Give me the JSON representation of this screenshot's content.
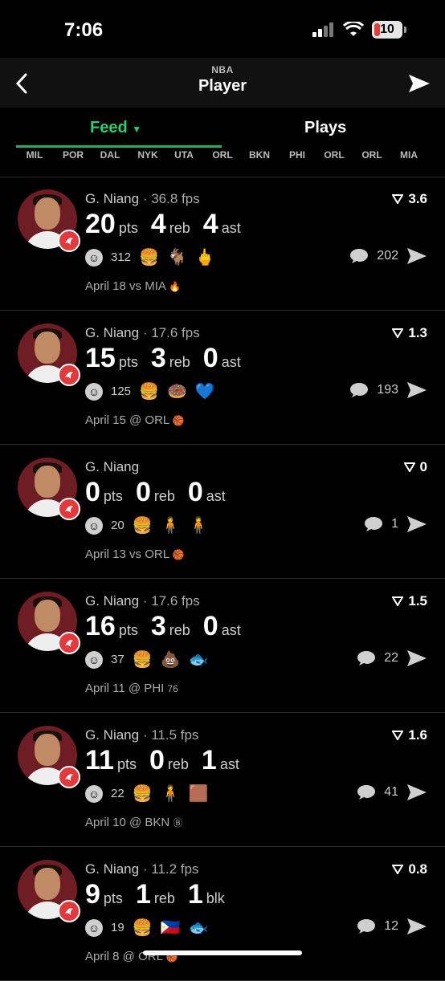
{
  "status": {
    "time": "7:06",
    "battery": "10"
  },
  "header": {
    "league": "NBA",
    "title": "Player"
  },
  "tabs": {
    "feed": "Feed",
    "plays": "Plays"
  },
  "teams": [
    "MIL",
    "POR",
    "DAL",
    "NYK",
    "UTA",
    "ORL",
    "BKN",
    "PHI",
    "ORL",
    "ORL",
    "MIA"
  ],
  "feed": [
    {
      "name": "G. Niang",
      "fps": " · 36.8 fps",
      "score": "3.6",
      "s1": "20",
      "u1": "pts",
      "s2": "4",
      "u2": "reb",
      "s3": "4",
      "u3": "ast",
      "reacts": "312",
      "emojis": [
        "🍔",
        "🐐",
        "🖕"
      ],
      "comments": "202",
      "date": "April 18 vs MIA",
      "logo": "🔥"
    },
    {
      "name": "G. Niang",
      "fps": " · 17.6 fps",
      "score": "1.3",
      "s1": "15",
      "u1": "pts",
      "s2": "3",
      "u2": "reb",
      "s3": "0",
      "u3": "ast",
      "reacts": "125",
      "emojis": [
        "🍔",
        "🍩",
        "💙"
      ],
      "comments": "193",
      "date": "April 15 @ ORL",
      "logo": "🏀"
    },
    {
      "name": "G. Niang",
      "fps": "",
      "score": "0",
      "s1": "0",
      "u1": "pts",
      "s2": "0",
      "u2": "reb",
      "s3": "0",
      "u3": "ast",
      "reacts": "20",
      "emojis": [
        "🍔",
        "🧍",
        "🧍"
      ],
      "comments": "1",
      "date": "April 13 vs ORL",
      "logo": "🏀"
    },
    {
      "name": "G. Niang",
      "fps": " · 17.6 fps",
      "score": "1.5",
      "s1": "16",
      "u1": "pts",
      "s2": "3",
      "u2": "reb",
      "s3": "0",
      "u3": "ast",
      "reacts": "37",
      "emojis": [
        "🍔",
        "💩",
        "🐟"
      ],
      "comments": "22",
      "date": "April 11 @ PHI",
      "logo": "76"
    },
    {
      "name": "G. Niang",
      "fps": " · 11.5 fps",
      "score": "1.6",
      "s1": "11",
      "u1": "pts",
      "s2": "0",
      "u2": "reb",
      "s3": "1",
      "u3": "ast",
      "reacts": "22",
      "emojis": [
        "🍔",
        "🧍",
        "🟫"
      ],
      "comments": "41",
      "date": "April 10 @ BKN",
      "logo": "Ⓑ"
    },
    {
      "name": "G. Niang",
      "fps": " · 11.2 fps",
      "score": "0.8",
      "s1": "9",
      "u1": "pts",
      "s2": "1",
      "u2": "reb",
      "s3": "1",
      "u3": "blk",
      "reacts": "19",
      "emojis": [
        "🍔",
        "🇵🇭",
        "🐟"
      ],
      "comments": "12",
      "date": "April 8 @ ORL",
      "logo": "🏀"
    }
  ]
}
